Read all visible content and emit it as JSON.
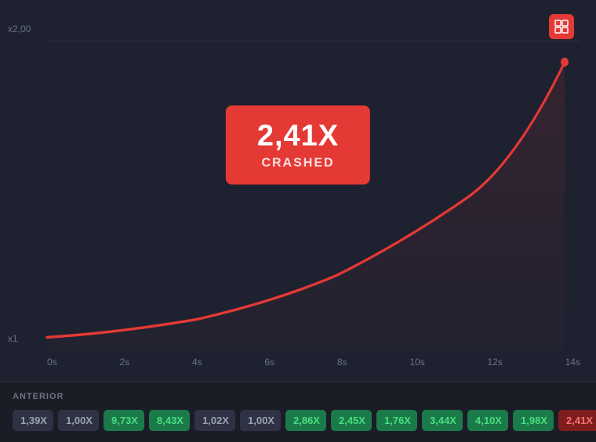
{
  "chart": {
    "y_labels": [
      "x2,00",
      "x1"
    ],
    "x_labels": [
      "0s",
      "2s",
      "4s",
      "6s",
      "8s",
      "10s",
      "12s",
      "14s"
    ],
    "crash_multiplier": "2,41X",
    "crash_label": "CRASHED",
    "accent_color": "#e53935"
  },
  "history": {
    "label": "ANTERIOR",
    "items": [
      {
        "value": "1,39X",
        "type": "gray"
      },
      {
        "value": "1,00X",
        "type": "gray"
      },
      {
        "value": "9,73X",
        "type": "green"
      },
      {
        "value": "8,43X",
        "type": "green"
      },
      {
        "value": "1,02X",
        "type": "gray"
      },
      {
        "value": "1,00X",
        "type": "gray"
      },
      {
        "value": "2,86X",
        "type": "green"
      },
      {
        "value": "2,45X",
        "type": "green"
      },
      {
        "value": "1,76X",
        "type": "green"
      },
      {
        "value": "3,44X",
        "type": "green"
      },
      {
        "value": "4,10X",
        "type": "green"
      },
      {
        "value": "1,98X",
        "type": "green"
      },
      {
        "value": "2,41X",
        "type": "red"
      }
    ]
  }
}
